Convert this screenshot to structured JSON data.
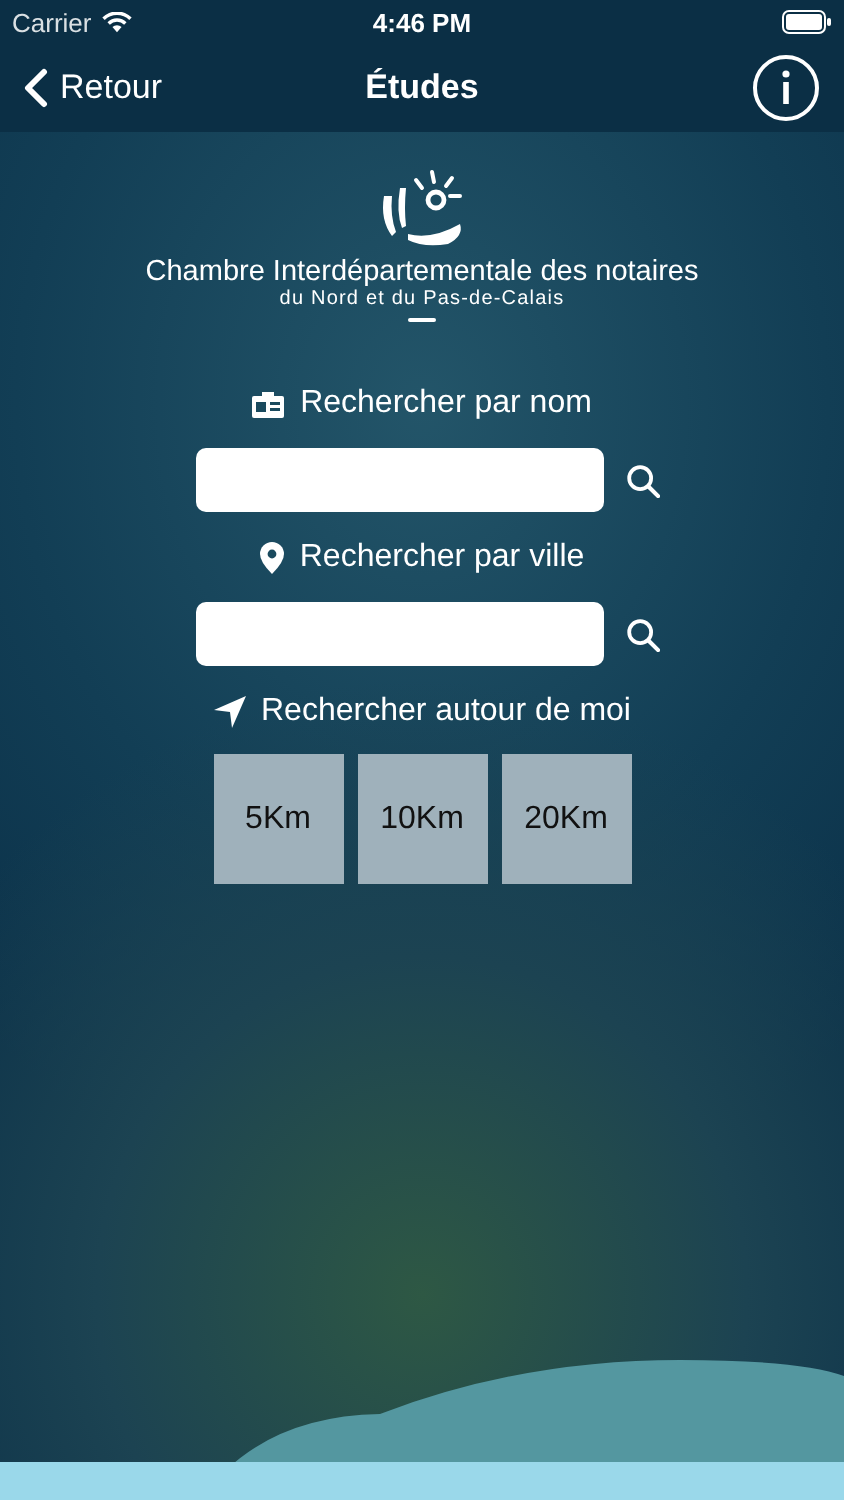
{
  "status_bar": {
    "carrier": "Carrier",
    "time": "4:46 PM"
  },
  "nav": {
    "back": "Retour",
    "title": "Études"
  },
  "logo": {
    "title": "Chambre Interdépartementale des notaires",
    "subtitle": "du Nord et du Pas-de-Calais"
  },
  "searches": [
    {
      "kind": "field",
      "label": "Rechercher par nom"
    },
    {
      "kind": "field",
      "label": "Rechercher par ville"
    },
    {
      "kind": "distance",
      "label": "Rechercher autour de moi",
      "options": [
        "5Km",
        "10Km",
        "20Km"
      ]
    }
  ]
}
